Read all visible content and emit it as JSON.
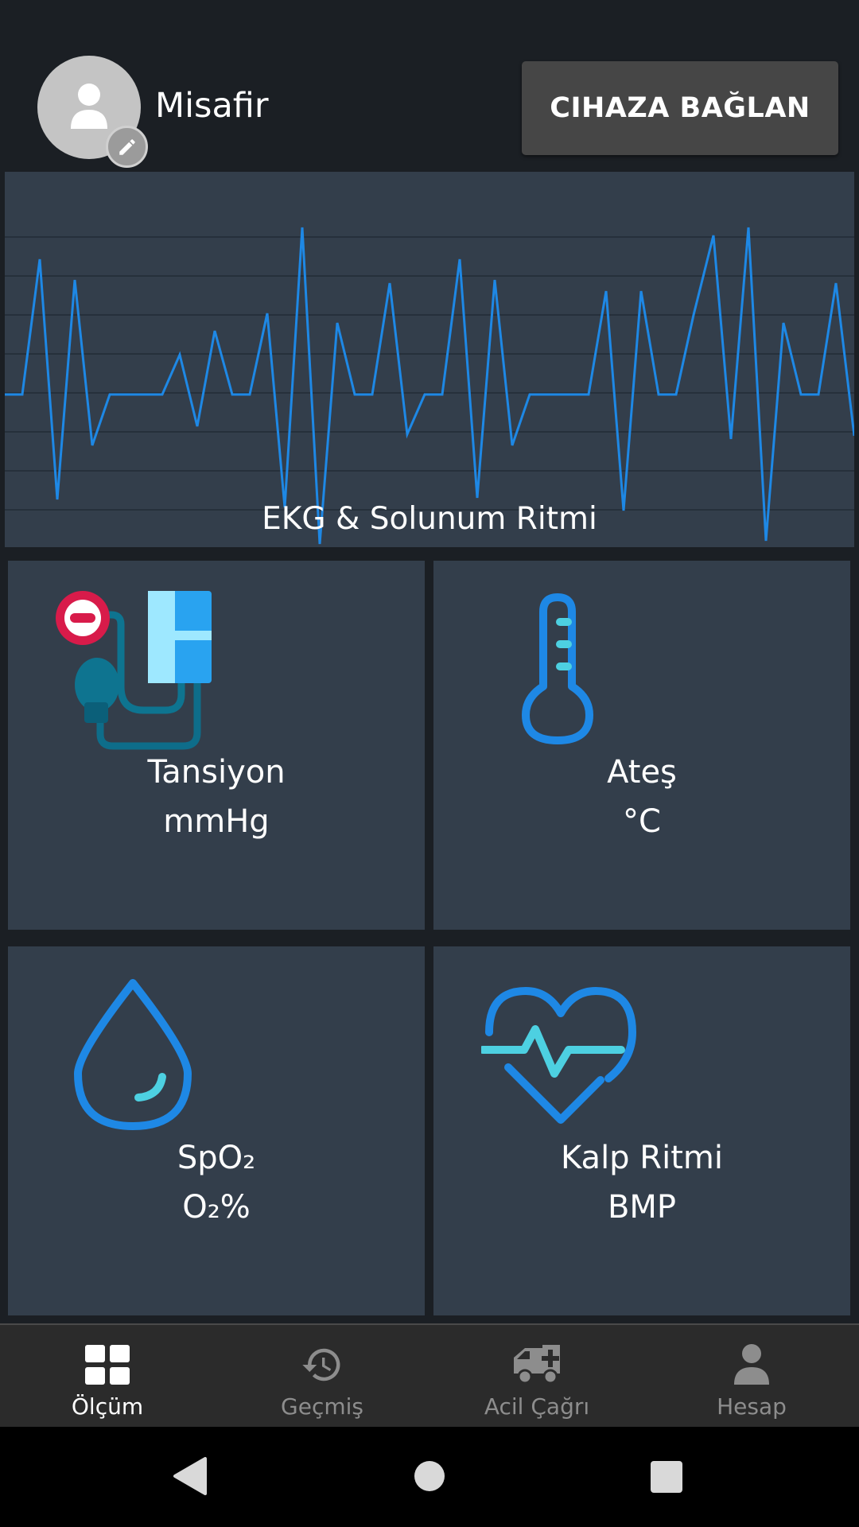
{
  "header": {
    "user_name": "Misafir",
    "connect_button": "CIHAZA BAĞLAN"
  },
  "ekg": {
    "label": "EKG & Solunum Ritmi",
    "line_color": "#1e88e5"
  },
  "tiles": [
    {
      "title": "Tansiyon",
      "unit": "mmHg",
      "icon": "blood-pressure-monitor-icon"
    },
    {
      "title": "Ateş",
      "unit": "°C",
      "icon": "thermometer-icon"
    },
    {
      "title": "SpO₂",
      "unit": "O₂%",
      "icon": "water-drop-icon"
    },
    {
      "title": "Kalp Ritmi",
      "unit": "BMP",
      "icon": "heart-pulse-icon"
    }
  ],
  "bottom_nav": {
    "items": [
      {
        "label": "Ölçüm",
        "icon": "dashboard-grid-icon",
        "active": true
      },
      {
        "label": "Geçmiş",
        "icon": "history-icon",
        "active": false
      },
      {
        "label": "Acil Çağrı",
        "icon": "ambulance-icon",
        "active": false
      },
      {
        "label": "Hesap",
        "icon": "person-icon",
        "active": false
      }
    ]
  },
  "colors": {
    "background": "#1b1f24",
    "panel": "#333e4b",
    "accent_blue": "#1e88e5",
    "accent_cyan": "#4dd0e1",
    "nav_bar": "#2b2b2b"
  }
}
